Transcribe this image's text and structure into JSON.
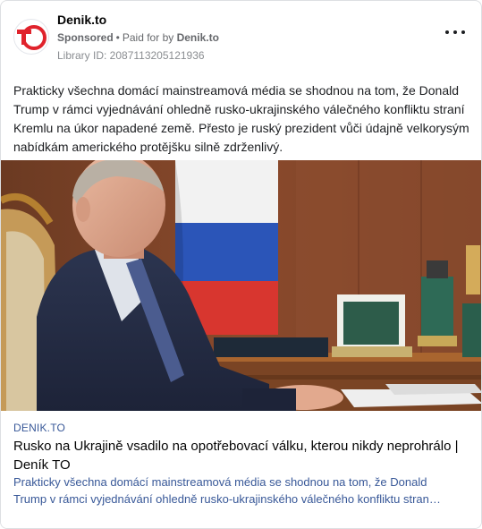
{
  "header": {
    "page_name": "Denik.to",
    "logo_text": "TO",
    "sponsored_label": "Sponsored",
    "separator": "•",
    "paid_for_label": "Paid for by",
    "paid_for_name": "Denik.to",
    "library_id": "Library ID: 2087113205121936",
    "more_icon": "more-horizontal-icon"
  },
  "post": {
    "text": "Prakticky všechna domácí mainstreamová média se shodnou na tom, že Donald Trump v rámci vyjednávání ohledně rusko-ukrajinského válečného konfliktu straní Kremlu na úkor napadené země. Přesto je ruský prezident vůči údajně velkorysým nabídkám amerického protějšku silně zdrženlivý."
  },
  "link": {
    "domain": "DENIK.TO",
    "headline": "Rusko na Ukrajině vsadilo na opotřebovací válku, kterou nikdy neprohrálo | Deník TO",
    "description_line1": "Prakticky všechna domácí mainstreamová média se shodnou na tom, že Donald",
    "description_line2": "Trump v rámci vyjednávání ohledně rusko-ukrajinského válečného konfliktu stran…"
  },
  "colors": {
    "brand_red": "#e0232c",
    "link_blue": "#385898"
  }
}
